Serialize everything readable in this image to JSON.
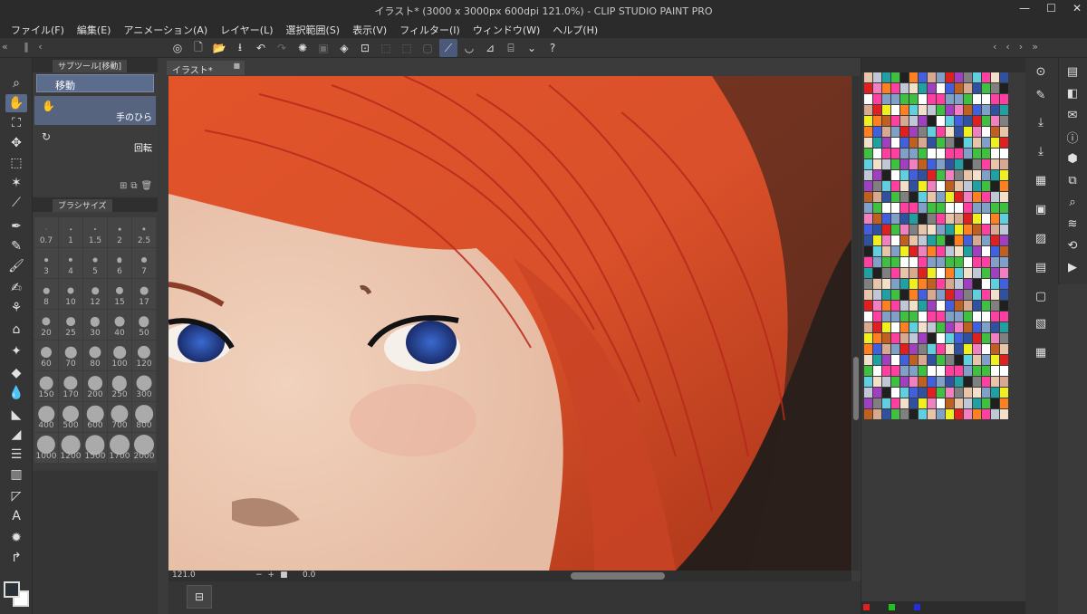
{
  "window": {
    "title": "イラスト* (3000 x 3000px 600dpi 121.0%)  - CLIP STUDIO PAINT PRO",
    "minimize": "—",
    "maximize": "☐",
    "close": "✕"
  },
  "menu": [
    {
      "label": "ファイル(F)"
    },
    {
      "label": "編集(E)"
    },
    {
      "label": "アニメーション(A)"
    },
    {
      "label": "レイヤー(L)"
    },
    {
      "label": "選択範囲(S)"
    },
    {
      "label": "表示(V)"
    },
    {
      "label": "フィルター(I)"
    },
    {
      "label": "ウィンドウ(W)"
    },
    {
      "label": "ヘルプ(H)"
    }
  ],
  "subtool_panel": {
    "tab_label": "サブツール[移動]",
    "group_label": "移動",
    "items": [
      {
        "label": "手のひら"
      },
      {
        "label": "回転"
      }
    ]
  },
  "brush_size_panel": {
    "tab_label": "ブラシサイズ",
    "sizes": [
      "0.7",
      "1",
      "1.5",
      "2",
      "2.5",
      "3",
      "4",
      "5",
      "6",
      "7",
      "8",
      "10",
      "12",
      "15",
      "17",
      "20",
      "25",
      "30",
      "40",
      "50",
      "60",
      "70",
      "80",
      "100",
      "120",
      "150",
      "170",
      "200",
      "250",
      "300",
      "400",
      "500",
      "600",
      "700",
      "800",
      "1000",
      "1200",
      "1500",
      "1700",
      "2000"
    ]
  },
  "document": {
    "tab_label": "イラスト*",
    "zoom": "121.0",
    "rotation": "0.0"
  },
  "colors": {
    "main_color": "#2a3038",
    "sub_color": "#ffffff",
    "accent": "#5a6a8a"
  }
}
